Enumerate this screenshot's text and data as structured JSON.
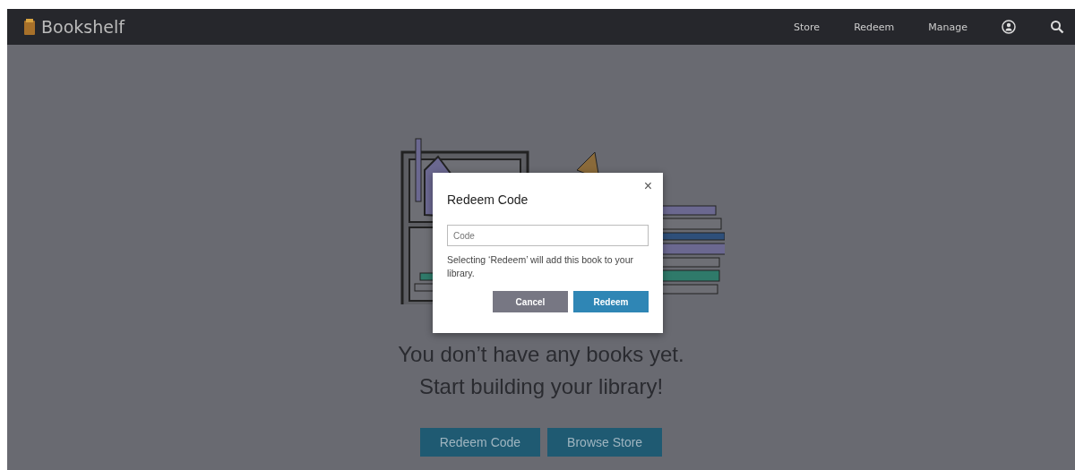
{
  "app_bar": {
    "title": "Bookshelf",
    "nav": [
      {
        "label": "Store"
      },
      {
        "label": "Redeem"
      },
      {
        "label": "Manage"
      }
    ]
  },
  "empty_state": {
    "lines": [
      "You don’t have any books yet.",
      "Start building your library!"
    ],
    "buttons": [
      {
        "label": "Redeem Code"
      },
      {
        "label": "Browse Store"
      }
    ]
  },
  "dialog": {
    "title": "Redeem Code",
    "close": "×",
    "field": {
      "placeholder": "Code"
    },
    "message": "Selecting ‘Redeem’ will add this book to your library.",
    "buttons": [
      {
        "label": "Cancel",
        "kind": "secondary"
      },
      {
        "label": "Redeem",
        "kind": "primary"
      }
    ]
  }
}
